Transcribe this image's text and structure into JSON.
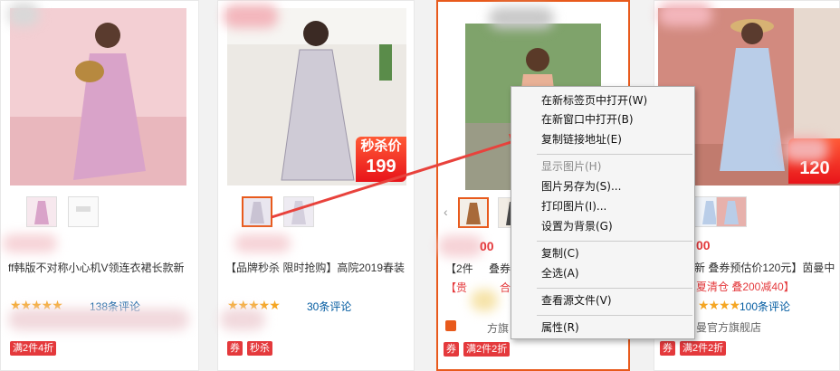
{
  "products": [
    {
      "title": "ff韩版不对称小心机V领连衣裙长款新",
      "rating_stars": "★★★★★",
      "reviews": "138条评论",
      "tags": [
        "满2件4折"
      ]
    },
    {
      "badge_line1": "秒杀价",
      "badge_line2": "199",
      "title": "【品牌秒杀 限时抢购】高院2019春装",
      "rating_stars": "★★★★★",
      "reviews": "30条评论",
      "tags": [
        "券",
        "秒杀"
      ]
    },
    {
      "price": "00",
      "title": "【2件",
      "title_tail": "叠券",
      "promo": "【贵",
      "promo_tail": "合",
      "shop_tail": "方旗",
      "tags": [
        "券",
        "满2件2折"
      ]
    },
    {
      "badge_line2": "120",
      "price": "00",
      "title": "新 叠券预估价120元】茵曼中",
      "promo": "夏清仓 叠200减40】",
      "rating_stars": "★★★★",
      "reviews": "100条评论",
      "shop": "曼官方旗舰店",
      "tags": [
        "券",
        "满2件2折"
      ]
    }
  ],
  "context_menu": {
    "items": [
      {
        "label": "在新标签页中打开(W)",
        "disabled": false
      },
      {
        "label": "在新窗口中打开(B)",
        "disabled": false
      },
      {
        "label": "复制链接地址(E)",
        "disabled": false
      },
      {
        "label": "显示图片(H)",
        "disabled": true
      },
      {
        "label": "图片另存为(S)...",
        "disabled": false
      },
      {
        "label": "打印图片(I)...",
        "disabled": false
      },
      {
        "label": "设置为背景(G)",
        "disabled": false
      },
      {
        "label": "复制(C)",
        "disabled": false
      },
      {
        "label": "全选(A)",
        "disabled": false
      },
      {
        "label": "查看源文件(V)",
        "disabled": false
      },
      {
        "label": "属性(R)",
        "disabled": false
      }
    ]
  },
  "colors": {
    "accent": "#e85a1c",
    "price": "#e4393c",
    "link": "#005aa0",
    "arrow": "#e8423c"
  }
}
